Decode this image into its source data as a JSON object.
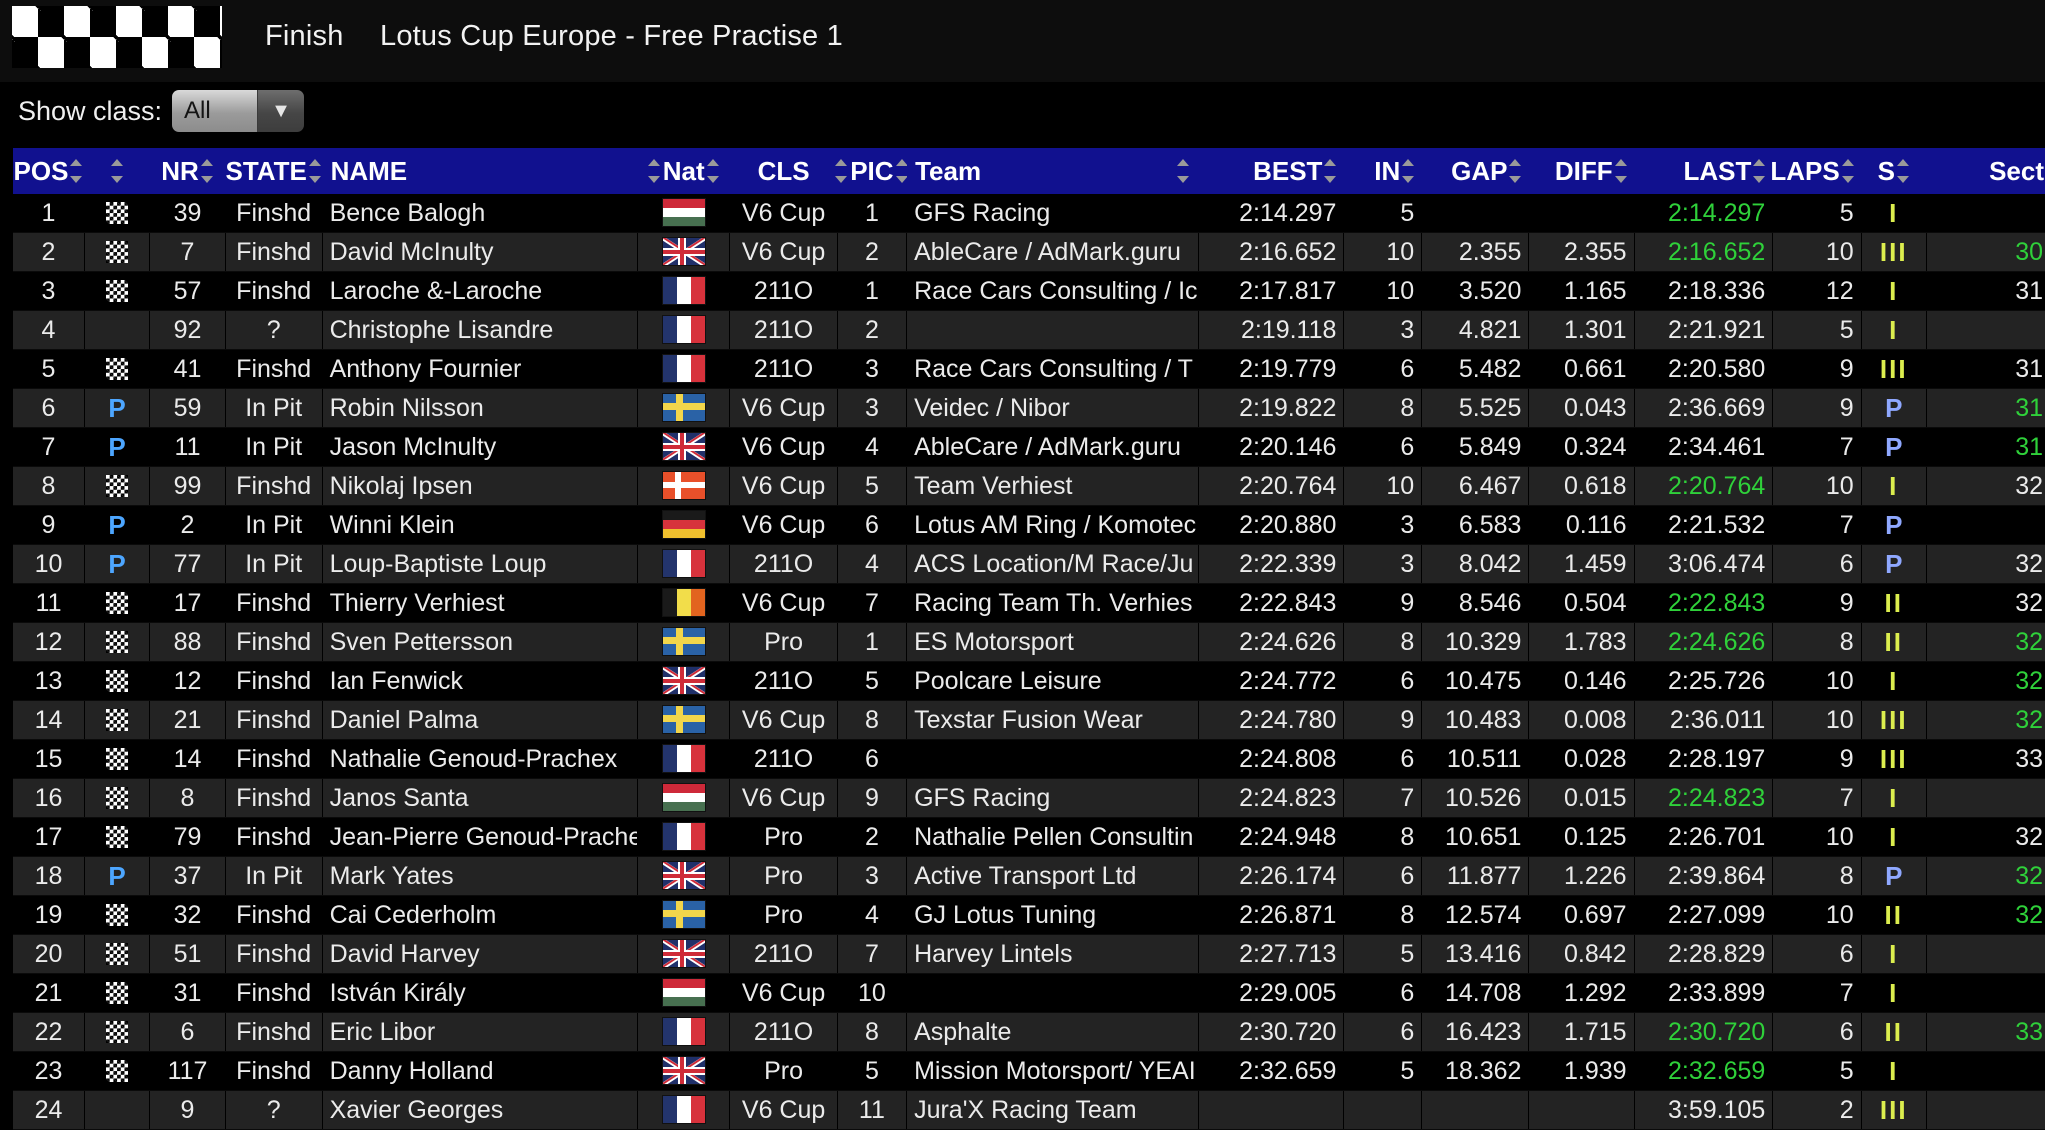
{
  "banner": {
    "finish_label": "Finish",
    "event_title": "Lotus Cup Europe - Free Practise 1",
    "logo_icon": "checkered-flag-icon"
  },
  "filter": {
    "label": "Show class:",
    "selected": "All",
    "arrow_icon": "chevron-down-icon"
  },
  "table": {
    "columns": [
      {
        "key": "pos",
        "label": "POS"
      },
      {
        "key": "flagicon",
        "label": ""
      },
      {
        "key": "nr",
        "label": "NR"
      },
      {
        "key": "state",
        "label": "STATE"
      },
      {
        "key": "name",
        "label": "NAME"
      },
      {
        "key": "nat",
        "label": "Nat"
      },
      {
        "key": "cls",
        "label": "CLS"
      },
      {
        "key": "pic",
        "label": "PIC"
      },
      {
        "key": "team",
        "label": "Team"
      },
      {
        "key": "best",
        "label": "BEST"
      },
      {
        "key": "in",
        "label": "IN"
      },
      {
        "key": "gap",
        "label": "GAP"
      },
      {
        "key": "diff",
        "label": "DIFF"
      },
      {
        "key": "last",
        "label": "LAST"
      },
      {
        "key": "laps",
        "label": "LAPS"
      },
      {
        "key": "s",
        "label": "S"
      },
      {
        "key": "sect",
        "label": "Sect"
      }
    ],
    "rows": [
      {
        "pos": "1",
        "icon": "checkered",
        "nr": "39",
        "state": "Finshd",
        "name": "Bence Balogh",
        "nat": "hu",
        "cls": "V6 Cup",
        "pic": "1",
        "team": "GFS Racing",
        "best": "2:14.297",
        "in": "5",
        "gap": "",
        "diff": "",
        "last": "2:14.297",
        "last_green": true,
        "laps": "5",
        "s": "I",
        "s_pit": false,
        "sect": "",
        "sect_green": false
      },
      {
        "pos": "2",
        "icon": "checkered",
        "nr": "7",
        "state": "Finshd",
        "name": "David McInulty",
        "nat": "gb",
        "cls": "V6 Cup",
        "pic": "2",
        "team": "AbleCare / AdMark.guru",
        "best": "2:16.652",
        "in": "10",
        "gap": "2.355",
        "diff": "2.355",
        "last": "2:16.652",
        "last_green": true,
        "laps": "10",
        "s": "III",
        "s_pit": false,
        "sect": "30",
        "sect_green": true
      },
      {
        "pos": "3",
        "icon": "checkered",
        "nr": "57",
        "state": "Finshd",
        "name": "Laroche &-Laroche",
        "nat": "fr",
        "cls": "211O",
        "pic": "1",
        "team": "Race Cars Consulting / Ic",
        "best": "2:17.817",
        "in": "10",
        "gap": "3.520",
        "diff": "1.165",
        "last": "2:18.336",
        "last_green": false,
        "laps": "12",
        "s": "I",
        "s_pit": false,
        "sect": "31",
        "sect_green": false
      },
      {
        "pos": "4",
        "icon": "",
        "nr": "92",
        "state": "?",
        "name": "Christophe Lisandre",
        "nat": "fr",
        "cls": "211O",
        "pic": "2",
        "team": "",
        "best": "2:19.118",
        "in": "3",
        "gap": "4.821",
        "diff": "1.301",
        "last": "2:21.921",
        "last_green": false,
        "laps": "5",
        "s": "I",
        "s_pit": false,
        "sect": "",
        "sect_green": false
      },
      {
        "pos": "5",
        "icon": "checkered",
        "nr": "41",
        "state": "Finshd",
        "name": "Anthony Fournier",
        "nat": "fr",
        "cls": "211O",
        "pic": "3",
        "team": "Race Cars Consulting / T",
        "best": "2:19.779",
        "in": "6",
        "gap": "5.482",
        "diff": "0.661",
        "last": "2:20.580",
        "last_green": false,
        "laps": "9",
        "s": "III",
        "s_pit": false,
        "sect": "31",
        "sect_green": false
      },
      {
        "pos": "6",
        "icon": "P",
        "nr": "59",
        "state": "In Pit",
        "name": "Robin Nilsson",
        "nat": "se",
        "cls": "V6 Cup",
        "pic": "3",
        "team": "Veidec / Nibor",
        "best": "2:19.822",
        "in": "8",
        "gap": "5.525",
        "diff": "0.043",
        "last": "2:36.669",
        "last_green": false,
        "laps": "9",
        "s": "P",
        "s_pit": true,
        "sect": "31",
        "sect_green": true
      },
      {
        "pos": "7",
        "icon": "P",
        "nr": "11",
        "state": "In Pit",
        "name": "Jason McInulty",
        "nat": "gb",
        "cls": "V6 Cup",
        "pic": "4",
        "team": "AbleCare / AdMark.guru",
        "best": "2:20.146",
        "in": "6",
        "gap": "5.849",
        "diff": "0.324",
        "last": "2:34.461",
        "last_green": false,
        "laps": "7",
        "s": "P",
        "s_pit": true,
        "sect": "31",
        "sect_green": true
      },
      {
        "pos": "8",
        "icon": "checkered",
        "nr": "99",
        "state": "Finshd",
        "name": "Nikolaj Ipsen",
        "nat": "dk",
        "cls": "V6 Cup",
        "pic": "5",
        "team": "Team Verhiest",
        "best": "2:20.764",
        "in": "10",
        "gap": "6.467",
        "diff": "0.618",
        "last": "2:20.764",
        "last_green": true,
        "laps": "10",
        "s": "I",
        "s_pit": false,
        "sect": "32",
        "sect_green": false
      },
      {
        "pos": "9",
        "icon": "P",
        "nr": "2",
        "state": "In Pit",
        "name": "Winni Klein",
        "nat": "de",
        "cls": "V6 Cup",
        "pic": "6",
        "team": "Lotus AM Ring / Komotec",
        "best": "2:20.880",
        "in": "3",
        "gap": "6.583",
        "diff": "0.116",
        "last": "2:21.532",
        "last_green": false,
        "laps": "7",
        "s": "P",
        "s_pit": true,
        "sect": "",
        "sect_green": false
      },
      {
        "pos": "10",
        "icon": "P",
        "nr": "77",
        "state": "In Pit",
        "name": "Loup-Baptiste Loup",
        "nat": "fr",
        "cls": "211O",
        "pic": "4",
        "team": "ACS Location/M Race/Ju",
        "best": "2:22.339",
        "in": "3",
        "gap": "8.042",
        "diff": "1.459",
        "last": "3:06.474",
        "last_green": false,
        "laps": "6",
        "s": "P",
        "s_pit": true,
        "sect": "32",
        "sect_green": false
      },
      {
        "pos": "11",
        "icon": "checkered",
        "nr": "17",
        "state": "Finshd",
        "name": "Thierry Verhiest",
        "nat": "be",
        "cls": "V6 Cup",
        "pic": "7",
        "team": "Racing Team Th. Verhies",
        "best": "2:22.843",
        "in": "9",
        "gap": "8.546",
        "diff": "0.504",
        "last": "2:22.843",
        "last_green": true,
        "laps": "9",
        "s": "II",
        "s_pit": false,
        "sect": "32",
        "sect_green": false
      },
      {
        "pos": "12",
        "icon": "checkered",
        "nr": "88",
        "state": "Finshd",
        "name": "Sven Pettersson",
        "nat": "se",
        "cls": "Pro",
        "pic": "1",
        "team": "ES Motorsport",
        "best": "2:24.626",
        "in": "8",
        "gap": "10.329",
        "diff": "1.783",
        "last": "2:24.626",
        "last_green": true,
        "laps": "8",
        "s": "II",
        "s_pit": false,
        "sect": "32",
        "sect_green": true
      },
      {
        "pos": "13",
        "icon": "checkered",
        "nr": "12",
        "state": "Finshd",
        "name": "Ian Fenwick",
        "nat": "gb",
        "cls": "211O",
        "pic": "5",
        "team": "Poolcare Leisure",
        "best": "2:24.772",
        "in": "6",
        "gap": "10.475",
        "diff": "0.146",
        "last": "2:25.726",
        "last_green": false,
        "laps": "10",
        "s": "I",
        "s_pit": false,
        "sect": "32",
        "sect_green": true
      },
      {
        "pos": "14",
        "icon": "checkered",
        "nr": "21",
        "state": "Finshd",
        "name": "Daniel Palma",
        "nat": "se",
        "cls": "V6 Cup",
        "pic": "8",
        "team": "Texstar Fusion Wear",
        "best": "2:24.780",
        "in": "9",
        "gap": "10.483",
        "diff": "0.008",
        "last": "2:36.011",
        "last_green": false,
        "laps": "10",
        "s": "III",
        "s_pit": false,
        "sect": "32",
        "sect_green": true
      },
      {
        "pos": "15",
        "icon": "checkered",
        "nr": "14",
        "state": "Finshd",
        "name": "Nathalie Genoud-Prachex",
        "nat": "fr",
        "cls": "211O",
        "pic": "6",
        "team": "",
        "best": "2:24.808",
        "in": "6",
        "gap": "10.511",
        "diff": "0.028",
        "last": "2:28.197",
        "last_green": false,
        "laps": "9",
        "s": "III",
        "s_pit": false,
        "sect": "33",
        "sect_green": false
      },
      {
        "pos": "16",
        "icon": "checkered",
        "nr": "8",
        "state": "Finshd",
        "name": "Janos Santa",
        "nat": "hu",
        "cls": "V6 Cup",
        "pic": "9",
        "team": "GFS Racing",
        "best": "2:24.823",
        "in": "7",
        "gap": "10.526",
        "diff": "0.015",
        "last": "2:24.823",
        "last_green": true,
        "laps": "7",
        "s": "I",
        "s_pit": false,
        "sect": "",
        "sect_green": false
      },
      {
        "pos": "17",
        "icon": "checkered",
        "nr": "79",
        "state": "Finshd",
        "name": "Jean-Pierre Genoud-Prachex",
        "nat": "fr",
        "cls": "Pro",
        "pic": "2",
        "team": "Nathalie Pellen Consultin",
        "best": "2:24.948",
        "in": "8",
        "gap": "10.651",
        "diff": "0.125",
        "last": "2:26.701",
        "last_green": false,
        "laps": "10",
        "s": "I",
        "s_pit": false,
        "sect": "32",
        "sect_green": false
      },
      {
        "pos": "18",
        "icon": "P",
        "nr": "37",
        "state": "In Pit",
        "name": "Mark Yates",
        "nat": "gb",
        "cls": "Pro",
        "pic": "3",
        "team": "Active Transport Ltd",
        "best": "2:26.174",
        "in": "6",
        "gap": "11.877",
        "diff": "1.226",
        "last": "2:39.864",
        "last_green": false,
        "laps": "8",
        "s": "P",
        "s_pit": true,
        "sect": "32",
        "sect_green": true
      },
      {
        "pos": "19",
        "icon": "checkered",
        "nr": "32",
        "state": "Finshd",
        "name": "Cai Cederholm",
        "nat": "se",
        "cls": "Pro",
        "pic": "4",
        "team": "GJ Lotus Tuning",
        "best": "2:26.871",
        "in": "8",
        "gap": "12.574",
        "diff": "0.697",
        "last": "2:27.099",
        "last_green": false,
        "laps": "10",
        "s": "II",
        "s_pit": false,
        "sect": "32",
        "sect_green": true
      },
      {
        "pos": "20",
        "icon": "checkered",
        "nr": "51",
        "state": "Finshd",
        "name": "David Harvey",
        "nat": "gb",
        "cls": "211O",
        "pic": "7",
        "team": "Harvey Lintels",
        "best": "2:27.713",
        "in": "5",
        "gap": "13.416",
        "diff": "0.842",
        "last": "2:28.829",
        "last_green": false,
        "laps": "6",
        "s": "I",
        "s_pit": false,
        "sect": "",
        "sect_green": false
      },
      {
        "pos": "21",
        "icon": "checkered",
        "nr": "31",
        "state": "Finshd",
        "name": "István Király",
        "nat": "hu",
        "cls": "V6 Cup",
        "pic": "10",
        "team": "",
        "best": "2:29.005",
        "in": "6",
        "gap": "14.708",
        "diff": "1.292",
        "last": "2:33.899",
        "last_green": false,
        "laps": "7",
        "s": "I",
        "s_pit": false,
        "sect": "",
        "sect_green": false
      },
      {
        "pos": "22",
        "icon": "checkered",
        "nr": "6",
        "state": "Finshd",
        "name": "Eric Libor",
        "nat": "fr",
        "cls": "211O",
        "pic": "8",
        "team": "Asphalte",
        "best": "2:30.720",
        "in": "6",
        "gap": "16.423",
        "diff": "1.715",
        "last": "2:30.720",
        "last_green": true,
        "laps": "6",
        "s": "II",
        "s_pit": false,
        "sect": "33",
        "sect_green": true
      },
      {
        "pos": "23",
        "icon": "checkered",
        "nr": "117",
        "state": "Finshd",
        "name": "Danny Holland",
        "nat": "gb",
        "cls": "Pro",
        "pic": "5",
        "team": "Mission Motorsport/ YEAI",
        "best": "2:32.659",
        "in": "5",
        "gap": "18.362",
        "diff": "1.939",
        "last": "2:32.659",
        "last_green": true,
        "laps": "5",
        "s": "I",
        "s_pit": false,
        "sect": "",
        "sect_green": false
      },
      {
        "pos": "24",
        "icon": "",
        "nr": "9",
        "state": "?",
        "name": "Xavier Georges",
        "nat": "fr",
        "cls": "V6 Cup",
        "pic": "11",
        "team": "Jura'X Racing Team",
        "best": "",
        "in": "",
        "gap": "",
        "diff": "",
        "last": "3:59.105",
        "last_green": false,
        "laps": "2",
        "s": "III",
        "s_pit": false,
        "sect": "",
        "sect_green": false
      }
    ]
  },
  "colors": {
    "header_blue": "#11118f",
    "green_best": "#2fd13a",
    "pit_blue": "#4da6ff",
    "sector_yellow": "#dcee4e"
  }
}
